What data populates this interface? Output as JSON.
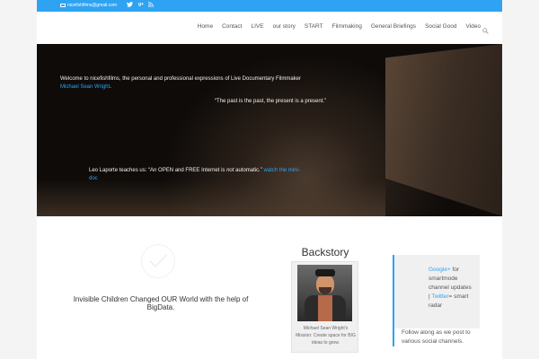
{
  "topbar": {
    "email": "nicefishfilms@gmail.com",
    "social": [
      {
        "icon": "twitter-icon"
      },
      {
        "icon": "google-plus-icon",
        "glyph": "g+"
      },
      {
        "icon": "rss-icon"
      }
    ]
  },
  "nav": {
    "items": [
      "Home",
      "Contact",
      "LIVE",
      "our story",
      "START",
      "Filmmaking",
      "General Briefings",
      "Social Good",
      "Video"
    ],
    "search_icon": "search-icon"
  },
  "hero": {
    "welcome_text": "Welcome to nicefishfilms, the personal and professional expressions of Live Documentary Filmmaker",
    "welcome_link": "Michael Sean Wright",
    "welcome_end": ".",
    "quote": "“The past is the past, the present is a present.”",
    "leo_prefix": "Leo Laporte teaches us: “An OPEN and FREE Internet is ",
    "leo_em": "not",
    "leo_mid": " automatic.” ",
    "leo_link": "watch the mini-doc"
  },
  "content": {
    "check_icon": "checkmark-icon",
    "invisible_children": "Invisible Children Changed OUR World with the help of BigData."
  },
  "backstory": {
    "title": "Backstory",
    "caption": "Michael Sean Wright's Mission: Create space for BIG ideas to grow."
  },
  "social_box": {
    "gplus_link": "Google+",
    "gplus_text": " for smartmode channel updates | ",
    "twitter_link": "Twitter",
    "twitter_text": "= smart radar",
    "follow_text": "Follow along as we post to various social channels."
  },
  "colors": {
    "accent": "#2ea3f2",
    "hero_dark": "#0e0b09",
    "nav_text": "#555555"
  }
}
